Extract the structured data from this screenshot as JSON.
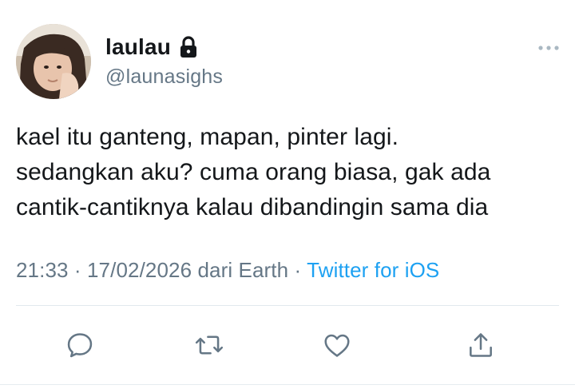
{
  "user": {
    "display_name": "laulau",
    "handle": "@launasighs",
    "protected": true,
    "avatar_icon": "profile-photo"
  },
  "tweet": {
    "lines": [
      "kael itu ganteng, mapan, pinter lagi.",
      "sedangkan aku? cuma orang biasa, gak ada",
      "cantik-cantiknya kalau dibandingin sama dia"
    ]
  },
  "meta": {
    "time": "21:33",
    "separator": "·",
    "date": "17/02/2026",
    "location": "dari Earth",
    "source": "Twitter for iOS"
  },
  "icons": {
    "more": "more-horizontal-icon",
    "reply": "reply-icon",
    "retweet": "retweet-icon",
    "like": "heart-icon",
    "share": "share-icon",
    "lock": "lock-icon"
  },
  "colors": {
    "text": "#14171a",
    "secondary": "#657786",
    "link": "#1da1f2",
    "icon": "#657786"
  }
}
